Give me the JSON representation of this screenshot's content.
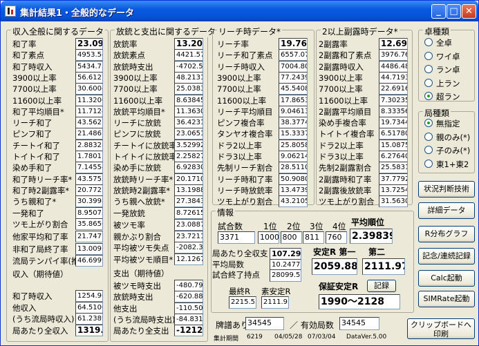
{
  "window": {
    "title": "集計結果1・全般的なデータ"
  },
  "col1": {
    "title": "収入全般に関するデータ",
    "rows": [
      {
        "label": "和了率",
        "value": "23.091",
        "bold": true
      },
      {
        "label": "和了素点",
        "value": "4953.54"
      },
      {
        "label": "和了時収入",
        "value": "5434.73"
      },
      {
        "label": "3900以上率",
        "value": "56.6127"
      },
      {
        "label": "7700以上率",
        "value": "30.6004"
      },
      {
        "label": "11600以上率",
        "value": "11.3200"
      },
      {
        "label": "和了平均順目*",
        "value": "11.7124"
      },
      {
        "label": "リーチ和了",
        "value": "43.5627"
      },
      {
        "label": "ピンフ和了",
        "value": "21.4867"
      },
      {
        "label": "チートイ和了",
        "value": "2.88328"
      },
      {
        "label": "トイトイ和了",
        "value": "1.78011"
      },
      {
        "label": "染め手和了",
        "value": "7.14554"
      },
      {
        "label": "和了時リーチ率*",
        "value": "43.5752"
      },
      {
        "label": "和了時2副露率*",
        "value": "20.7722"
      },
      {
        "label": "うち親和了*",
        "value": "30.3998"
      },
      {
        "label": "一発和了",
        "value": "8.95073"
      },
      {
        "label": "ツモ上がり割合",
        "value": "35.8656"
      }
    ],
    "rows2": [
      {
        "label": "他家平均和了率",
        "value": "21.7477"
      },
      {
        "label": "非和了局終了率",
        "value": "13.0091"
      },
      {
        "label": "流局テンパイ率(推)",
        "value": "46.6999"
      }
    ],
    "expect_title": "収入（期待値）",
    "rows3": [
      {
        "label": "和了時収入",
        "value": "1254.96"
      },
      {
        "label": "他収入",
        "value": "64.5100"
      },
      {
        "label": "(うち流局時収入)",
        "value": "61.2389"
      },
      {
        "label": "局あたり全収入",
        "value": "1319.47",
        "bold": true
      }
    ]
  },
  "col2": {
    "title": "放銃と支出に関するデータ",
    "rows": [
      {
        "label": "放銃率",
        "value": "13.203",
        "bold": true
      },
      {
        "label": "放銃素点",
        "value": "4421.57"
      },
      {
        "label": "放銃時支出",
        "value": "-4702.5"
      },
      {
        "label": "3900以上率",
        "value": "48.2131"
      },
      {
        "label": "7700以上率",
        "value": "25.0383"
      },
      {
        "label": "11600以上率",
        "value": "8.63845"
      },
      {
        "label": "放銃平均順目*",
        "value": "11.3630"
      },
      {
        "label": "リーチに放銃",
        "value": "36.4231"
      },
      {
        "label": "ピンフに放銃",
        "value": "23.0651"
      },
      {
        "label": "チートイに放銃率",
        "value": "3.52992"
      },
      {
        "label": "トイトイに放銃率",
        "value": "2.25827"
      },
      {
        "label": "染め手に放銃",
        "value": "6.92830"
      },
      {
        "label": "放銃時リーチ率*",
        "value": "20.1710"
      },
      {
        "label": "放銃時2副露率*",
        "value": "13.1988"
      },
      {
        "label": "うち親へ放銃*",
        "value": "27.3843"
      },
      {
        "label": "一発放銃",
        "value": "8.72615"
      }
    ],
    "rows2": [
      {
        "label": "被ツモ率",
        "value": "23.0887"
      },
      {
        "label": "親かぶり割合",
        "value": "23.7211"
      },
      {
        "label": "平均被ツモ失点",
        "value": "-2082.3"
      },
      {
        "label": "平均被ツモ順目*",
        "value": "12.1267"
      }
    ],
    "expend_title": "支出（期待値）",
    "rows3": [
      {
        "label": "被ツモ時支出",
        "value": "-480.79"
      },
      {
        "label": "放銃時支出",
        "value": "-620.88"
      },
      {
        "label": "他支出",
        "value": "-110.50"
      },
      {
        "label": "(うち流局時支出)",
        "value": "-84.831"
      },
      {
        "label": "局あたり全支出",
        "value": "-1212.1",
        "bold": true
      }
    ]
  },
  "col3": {
    "title": "リーチ時データ*",
    "rows": [
      {
        "label": "リーチ率",
        "value": "19.765",
        "bold": true
      },
      {
        "label": "リーチ和了素点",
        "value": "6557.07"
      },
      {
        "label": "リーチ時収入",
        "value": "7004.80"
      },
      {
        "label": "3900以上率",
        "value": "77.2439"
      },
      {
        "label": "7700以上率",
        "value": "45.5408"
      },
      {
        "label": "11600以上率",
        "value": "17.8653"
      },
      {
        "label": "リーチ平均順目",
        "value": "9.04613"
      },
      {
        "label": "ピンフ複合率",
        "value": "38.3774"
      },
      {
        "label": "タンヤオ複合率",
        "value": "15.3337"
      },
      {
        "label": "ドラ2以上率",
        "value": "25.8058"
      },
      {
        "label": "ドラ3以上率",
        "value": "9.06214"
      },
      {
        "label": "先制リーチ割合",
        "value": "28.5110"
      },
      {
        "label": "リーチ時和了率",
        "value": "50.9080"
      },
      {
        "label": "リーチ時放銃率",
        "value": "13.4739"
      },
      {
        "label": "ツモ上がり割合",
        "value": "43.2105"
      }
    ]
  },
  "col4": {
    "title": "2以上副露時データ*",
    "rows": [
      {
        "label": "2副露率",
        "value": "12.696",
        "bold": true
      },
      {
        "label": "2副露和了素点",
        "value": "3976.76"
      },
      {
        "label": "2副露時収入",
        "value": "4486.48"
      },
      {
        "label": "3900以上率",
        "value": "44.7193"
      },
      {
        "label": "7700以上率",
        "value": "22.6916"
      },
      {
        "label": "11600以上率",
        "value": "7.30235"
      },
      {
        "label": "2副露平均順目",
        "value": "8.33356"
      },
      {
        "label": "染め手複合率",
        "value": "19.7344"
      },
      {
        "label": "トイトイ複合率",
        "value": "6.51780"
      },
      {
        "label": "ドラ2以上率",
        "value": "15.0875"
      },
      {
        "label": "ドラ3以上率",
        "value": "6.27640"
      },
      {
        "label": "先制2副露割合",
        "value": "25.5831"
      },
      {
        "label": "2副露時和了率",
        "value": "37.7792"
      },
      {
        "label": "2副露後放銃率",
        "value": "13.7254"
      },
      {
        "label": "ツモ上がり割合",
        "value": "31.5630"
      }
    ]
  },
  "table_type": {
    "title": "卓種類",
    "options": [
      "全卓",
      "ワイ卓",
      "ラン卓",
      "上ラン",
      "超ラン"
    ],
    "selected": 4
  },
  "round_type": {
    "title": "局種類",
    "options": [
      "無指定",
      "親のみ(*)",
      "子のみ(*)",
      "東1+東2"
    ],
    "selected": 0
  },
  "buttons": {
    "situation": "状況判断技術",
    "detail": "詳細データ",
    "rdist": "R分布グラフ",
    "memorial": "記念/連続記録",
    "calc": "Calc起動",
    "simrate": "SIMRate起動",
    "clipboard": "クリップボードへ",
    "print": "印刷",
    "record": "記録"
  },
  "info": {
    "title": "情報",
    "games_label": "試合数",
    "games": "3371",
    "ranks": [
      "1位",
      "2位",
      "3位",
      "4位"
    ],
    "rank_values": [
      "1000",
      "800",
      "811",
      "760"
    ],
    "avg_rank_label": "平均順位",
    "avg_rank": "2.39839",
    "income_label": "局あたり全収支",
    "income": "107.297",
    "avg_rounds_label": "平均局数",
    "avg_rounds": "10.24770",
    "end_points_label": "試合終了持点",
    "end_points": "28099.55",
    "stable_r1_label": "安定R 第一",
    "stable_r1": "2059.88",
    "stable_r2_label": "第二",
    "stable_r2": "2111.970",
    "final_r_label": "最終R",
    "final_r": "2215.55",
    "moment_r_label": "素安定R",
    "moment_r": "2111.93",
    "guaranteed_label": "保証安定R",
    "guaranteed": "1990〜2128"
  },
  "footer": {
    "paifu_label": "牌譜あり",
    "paifu": "34545",
    "valid_label": "／ 有効局数",
    "valid": "34545",
    "period_label": "集計期間",
    "period_count": "6219",
    "date_from": "04/05/28",
    "date_to": "07/03/04",
    "version": "DataVer.5.00"
  }
}
